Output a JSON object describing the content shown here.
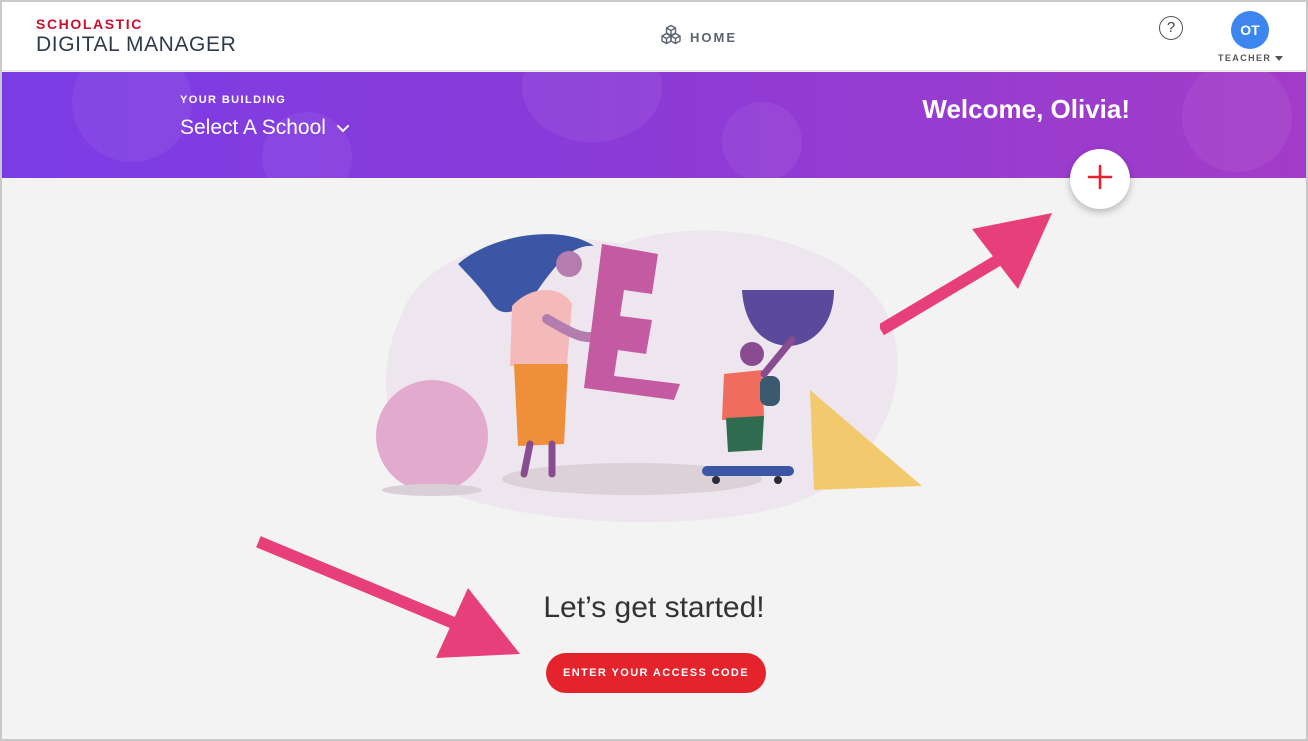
{
  "header": {
    "brand_top": "SCHOLASTIC",
    "brand_bottom": "DIGITAL MANAGER",
    "home_label": "HOME",
    "help_symbol": "?",
    "avatar_initials": "OT",
    "role_label": "TEACHER"
  },
  "banner": {
    "building_label": "YOUR BUILDING",
    "school_select_value": "Select A School",
    "welcome_text": "Welcome, Olivia!"
  },
  "main": {
    "heading": "Let’s get started!",
    "cta_label": "ENTER YOUR ACCESS CODE"
  },
  "icons": {
    "home": "cubes-icon",
    "add": "plus-icon",
    "select": "chevron-down-icon"
  },
  "colors": {
    "brand_red": "#c8102e",
    "banner_start": "#7b3ce6",
    "banner_end": "#a33cc8",
    "avatar_blue": "#3d86f0",
    "cta_red": "#e5232d",
    "annotation_arrow": "#e63f7a"
  }
}
